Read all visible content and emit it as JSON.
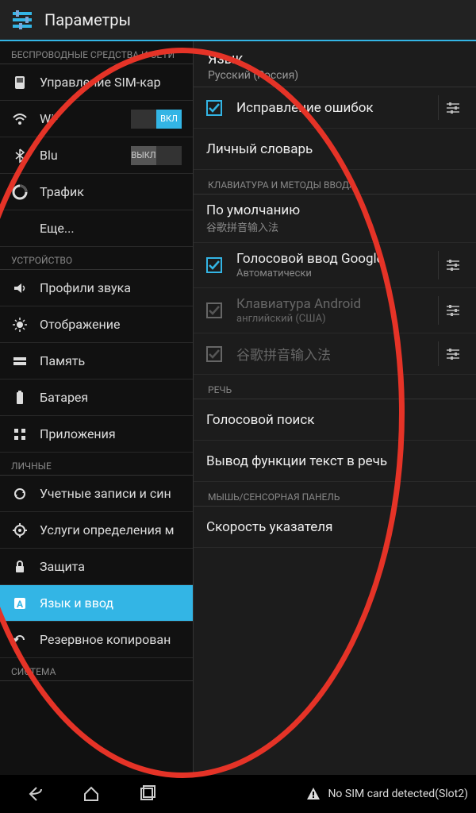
{
  "appbar": {
    "title": "Параметры"
  },
  "left": {
    "sections": [
      {
        "header": "БЕСПРОВОДНЫЕ СРЕДСТВА И СЕТИ",
        "items": [
          {
            "id": "sim",
            "label": "Управление SIM-кар",
            "selected": false
          },
          {
            "id": "wifi",
            "label": "Wi-",
            "toggle": "on",
            "toggle_on": "ВКЛ",
            "toggle_off": "",
            "selected": false
          },
          {
            "id": "bt",
            "label": "Blu",
            "toggle": "off",
            "toggle_on": "",
            "toggle_off": "ВЫКЛ",
            "selected": false
          },
          {
            "id": "traffic",
            "label": "Трафик",
            "selected": false
          },
          {
            "id": "more",
            "label": "Еще...",
            "selected": false,
            "noicon": true
          }
        ]
      },
      {
        "header": "УСТРОЙСТВО",
        "items": [
          {
            "id": "sound",
            "label": "Профили звука",
            "selected": false
          },
          {
            "id": "display",
            "label": "Отображение",
            "selected": false
          },
          {
            "id": "memory",
            "label": "Память",
            "selected": false
          },
          {
            "id": "battery",
            "label": "Батарея",
            "selected": false
          },
          {
            "id": "apps",
            "label": "Приложения",
            "selected": false
          }
        ]
      },
      {
        "header": "ЛИЧНЫЕ",
        "items": [
          {
            "id": "accounts",
            "label": "Учетные записи и син",
            "selected": false
          },
          {
            "id": "location",
            "label": "Услуги определения м",
            "selected": false
          },
          {
            "id": "security",
            "label": "Защита",
            "selected": false
          },
          {
            "id": "lang",
            "label": "Язык и ввод",
            "selected": true
          },
          {
            "id": "backup",
            "label": "Резервное копирован",
            "selected": false
          }
        ]
      },
      {
        "header": "СИСТЕМА",
        "items": []
      }
    ]
  },
  "right": {
    "top": {
      "title": "Язык",
      "sub": "Русский (Россия)"
    },
    "spellcheck": {
      "label": "Исправление ошибок",
      "checked": true
    },
    "dictionary": {
      "label": "Личный словарь"
    },
    "sections": [
      {
        "header": "КЛАВИАТУРА И МЕТОДЫ ВВОДА",
        "items": [
          {
            "id": "default",
            "label": "По умолчанию",
            "sub": "谷歌拼音输入法",
            "check": null,
            "settings": false
          },
          {
            "id": "voice",
            "label": "Голосовой ввод Google",
            "sub": "Автоматически",
            "check": true,
            "settings": true
          },
          {
            "id": "androidkb",
            "label": "Клавиатура Android",
            "sub": "английский (США)",
            "check": false,
            "dim": true,
            "settings": true
          },
          {
            "id": "pinyin",
            "label": "谷歌拼音输入法",
            "sub": null,
            "check": true,
            "dim": true,
            "settings": true
          }
        ]
      },
      {
        "header": "РЕЧЬ",
        "items": [
          {
            "id": "vsearch",
            "label": "Голосовой поиск",
            "sub": null,
            "check": null,
            "settings": false
          },
          {
            "id": "tts",
            "label": "Вывод функции текст в речь",
            "sub": null,
            "check": null,
            "settings": false
          }
        ]
      },
      {
        "header": "МЫШЬ/СЕНСОРНАЯ ПАНЕЛЬ",
        "items": [
          {
            "id": "pointer",
            "label": "Скорость указателя",
            "sub": null,
            "check": null,
            "settings": false
          }
        ]
      }
    ]
  },
  "navbar": {
    "status": "No SIM card detected(Slot2)"
  }
}
